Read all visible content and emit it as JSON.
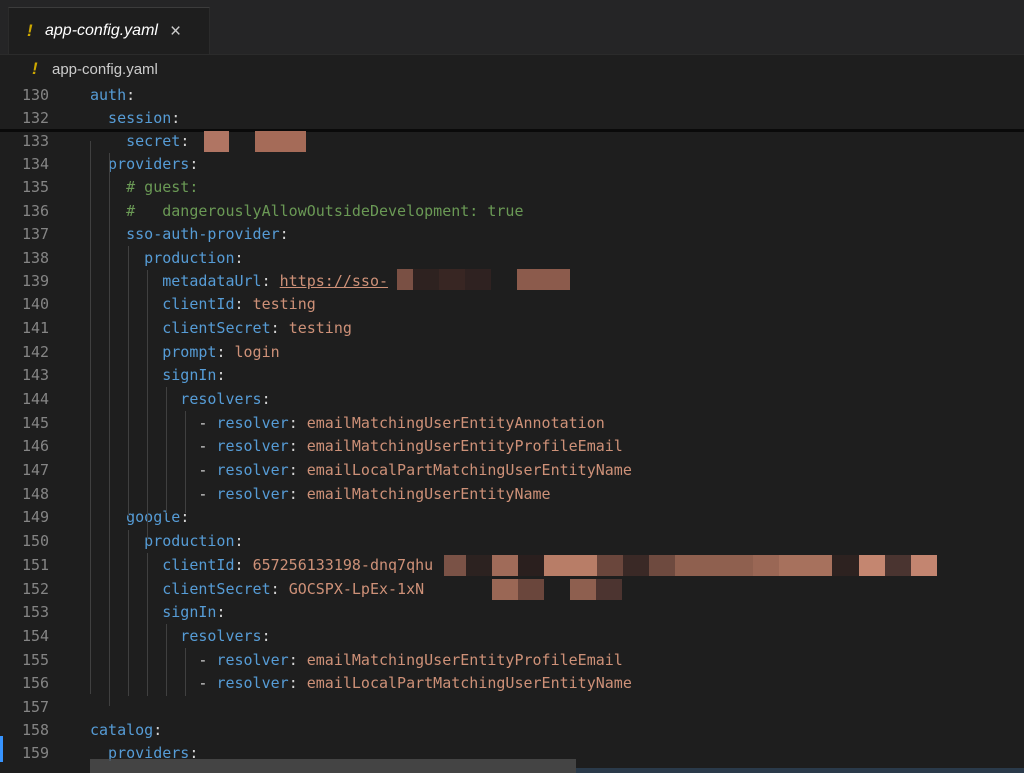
{
  "tab": {
    "icon": "yaml-warning-icon",
    "title": "app-config.yaml",
    "close": "×"
  },
  "breadcrumb": {
    "icon": "yaml-warning-icon",
    "title": "app-config.yaml"
  },
  "colors": {
    "key": "#569cd6",
    "string": "#ce9178",
    "comment": "#6a9955",
    "plain": "#d4d4d4",
    "line_number": "#858585",
    "accent": "#3794ff"
  },
  "lines": [
    {
      "n": "130",
      "parts": [
        {
          "t": "auth",
          "c": "k"
        },
        {
          "t": ":",
          "c": "p"
        }
      ]
    },
    {
      "n": "132",
      "parts": [
        {
          "t": "  session",
          "c": "k"
        },
        {
          "t": ":",
          "c": "p"
        }
      ]
    },
    {
      "n": "133",
      "parts": [
        {
          "t": "    secret",
          "c": "k"
        },
        {
          "t": ": ",
          "c": "p"
        }
      ]
    },
    {
      "n": "134",
      "parts": [
        {
          "t": "  providers",
          "c": "k"
        },
        {
          "t": ":",
          "c": "p"
        }
      ]
    },
    {
      "n": "135",
      "parts": [
        {
          "t": "    # guest:",
          "c": "c"
        }
      ]
    },
    {
      "n": "136",
      "parts": [
        {
          "t": "    #   dangerouslyAllowOutsideDevelopment: true",
          "c": "c"
        }
      ]
    },
    {
      "n": "137",
      "parts": [
        {
          "t": "    sso-auth-provider",
          "c": "k"
        },
        {
          "t": ":",
          "c": "p"
        }
      ]
    },
    {
      "n": "138",
      "parts": [
        {
          "t": "      production",
          "c": "k"
        },
        {
          "t": ":",
          "c": "p"
        }
      ]
    },
    {
      "n": "139",
      "parts": [
        {
          "t": "        metadataUrl",
          "c": "k"
        },
        {
          "t": ": ",
          "c": "p"
        },
        {
          "t": "https://sso-",
          "c": "u"
        }
      ]
    },
    {
      "n": "140",
      "parts": [
        {
          "t": "        clientId",
          "c": "k"
        },
        {
          "t": ": ",
          "c": "p"
        },
        {
          "t": "testing",
          "c": "s"
        }
      ]
    },
    {
      "n": "141",
      "parts": [
        {
          "t": "        clientSecret",
          "c": "k"
        },
        {
          "t": ": ",
          "c": "p"
        },
        {
          "t": "testing",
          "c": "s"
        }
      ]
    },
    {
      "n": "142",
      "parts": [
        {
          "t": "        prompt",
          "c": "k"
        },
        {
          "t": ": ",
          "c": "p"
        },
        {
          "t": "login",
          "c": "s"
        }
      ]
    },
    {
      "n": "143",
      "parts": [
        {
          "t": "        signIn",
          "c": "k"
        },
        {
          "t": ":",
          "c": "p"
        }
      ]
    },
    {
      "n": "144",
      "parts": [
        {
          "t": "          resolvers",
          "c": "k"
        },
        {
          "t": ":",
          "c": "p"
        }
      ]
    },
    {
      "n": "145",
      "parts": [
        {
          "t": "            - ",
          "c": "p"
        },
        {
          "t": "resolver",
          "c": "k"
        },
        {
          "t": ": ",
          "c": "p"
        },
        {
          "t": "emailMatchingUserEntityAnnotation",
          "c": "s"
        }
      ]
    },
    {
      "n": "146",
      "parts": [
        {
          "t": "            - ",
          "c": "p"
        },
        {
          "t": "resolver",
          "c": "k"
        },
        {
          "t": ": ",
          "c": "p"
        },
        {
          "t": "emailMatchingUserEntityProfileEmail",
          "c": "s"
        }
      ]
    },
    {
      "n": "147",
      "parts": [
        {
          "t": "            - ",
          "c": "p"
        },
        {
          "t": "resolver",
          "c": "k"
        },
        {
          "t": ": ",
          "c": "p"
        },
        {
          "t": "emailLocalPartMatchingUserEntityName",
          "c": "s"
        }
      ]
    },
    {
      "n": "148",
      "parts": [
        {
          "t": "            - ",
          "c": "p"
        },
        {
          "t": "resolver",
          "c": "k"
        },
        {
          "t": ": ",
          "c": "p"
        },
        {
          "t": "emailMatchingUserEntityName",
          "c": "s"
        }
      ]
    },
    {
      "n": "149",
      "parts": [
        {
          "t": "    google",
          "c": "k"
        },
        {
          "t": ":",
          "c": "p"
        }
      ]
    },
    {
      "n": "150",
      "parts": [
        {
          "t": "      production",
          "c": "k"
        },
        {
          "t": ":",
          "c": "p"
        }
      ]
    },
    {
      "n": "151",
      "parts": [
        {
          "t": "        clientId",
          "c": "k"
        },
        {
          "t": ": ",
          "c": "p"
        },
        {
          "t": "657256133198-dnq7qhu",
          "c": "s"
        }
      ]
    },
    {
      "n": "152",
      "parts": [
        {
          "t": "        clientSecret",
          "c": "k"
        },
        {
          "t": ": ",
          "c": "p"
        },
        {
          "t": "GOCSPX-LpEx-1xN",
          "c": "s"
        }
      ]
    },
    {
      "n": "153",
      "parts": [
        {
          "t": "        signIn",
          "c": "k"
        },
        {
          "t": ":",
          "c": "p"
        }
      ]
    },
    {
      "n": "154",
      "parts": [
        {
          "t": "          resolvers",
          "c": "k"
        },
        {
          "t": ":",
          "c": "p"
        }
      ]
    },
    {
      "n": "155",
      "parts": [
        {
          "t": "            - ",
          "c": "p"
        },
        {
          "t": "resolver",
          "c": "k"
        },
        {
          "t": ": ",
          "c": "p"
        },
        {
          "t": "emailMatchingUserEntityProfileEmail",
          "c": "s"
        }
      ]
    },
    {
      "n": "156",
      "parts": [
        {
          "t": "            - ",
          "c": "p"
        },
        {
          "t": "resolver",
          "c": "k"
        },
        {
          "t": ": ",
          "c": "p"
        },
        {
          "t": "emailLocalPartMatchingUserEntityName",
          "c": "s"
        }
      ]
    },
    {
      "n": "157",
      "parts": []
    },
    {
      "n": "158",
      "parts": [
        {
          "t": "catalog",
          "c": "k"
        },
        {
          "t": ":",
          "c": "p"
        }
      ]
    },
    {
      "n": "159",
      "parts": [
        {
          "t": "  providers",
          "c": "k"
        },
        {
          "t": ":",
          "c": "p"
        }
      ]
    }
  ]
}
